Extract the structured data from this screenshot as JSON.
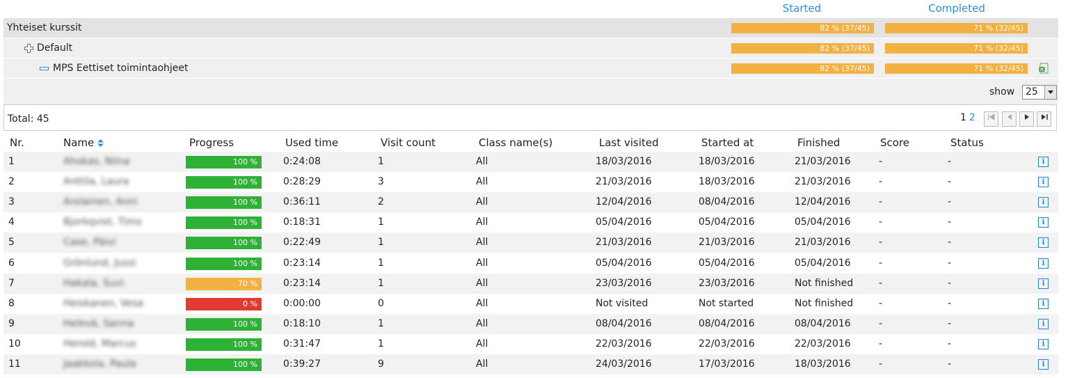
{
  "summary": {
    "started_header": "Started",
    "completed_header": "Completed",
    "rows": [
      {
        "label": "Yhteiset kurssit",
        "started": "82 % (37/45)",
        "completed": "71 % (32/45)"
      },
      {
        "label": "Default",
        "started": "82 % (37/45)",
        "completed": "71 % (32/45)"
      },
      {
        "label": "MPS Eettiset toimintaohjeet",
        "started": "82 % (37/45)",
        "completed": "71 % (32/45)"
      }
    ]
  },
  "show": {
    "label": "show",
    "value": "25"
  },
  "total": "Total: 45",
  "pagination": {
    "page1": "1",
    "page2": "2"
  },
  "colors": {
    "accent": "#2a8fd4",
    "green": "#2eb236",
    "orange": "#f3b043",
    "red": "#e23a33"
  },
  "columns": [
    "Nr.",
    "Name",
    "Progress",
    "Used time",
    "Visit count",
    "Class name(s)",
    "Last visited",
    "Started at",
    "Finished",
    "Score",
    "Status"
  ],
  "rows": [
    {
      "nr": "1",
      "name": "Ahokas, Niina",
      "progress": "100 %",
      "pval": 100,
      "used": "0:24:08",
      "visits": "1",
      "cls": "All",
      "last": "18/03/2016",
      "started": "18/03/2016",
      "finished": "21/03/2016",
      "score": "-",
      "status": "-"
    },
    {
      "nr": "2",
      "name": "Anttila, Laura",
      "progress": "100 %",
      "pval": 100,
      "used": "0:28:29",
      "visits": "3",
      "cls": "All",
      "last": "21/03/2016",
      "started": "18/03/2016",
      "finished": "21/03/2016",
      "score": "-",
      "status": "-"
    },
    {
      "nr": "3",
      "name": "Arolainen, Anni",
      "progress": "100 %",
      "pval": 100,
      "used": "0:36:11",
      "visits": "2",
      "cls": "All",
      "last": "12/04/2016",
      "started": "08/04/2016",
      "finished": "12/04/2016",
      "score": "-",
      "status": "-"
    },
    {
      "nr": "4",
      "name": "Bjorkqvist, Timo",
      "progress": "100 %",
      "pval": 100,
      "used": "0:18:31",
      "visits": "1",
      "cls": "All",
      "last": "05/04/2016",
      "started": "05/04/2016",
      "finished": "05/04/2016",
      "score": "-",
      "status": "-"
    },
    {
      "nr": "5",
      "name": "Case, Päivi",
      "progress": "100 %",
      "pval": 100,
      "used": "0:22:49",
      "visits": "1",
      "cls": "All",
      "last": "21/03/2016",
      "started": "21/03/2016",
      "finished": "21/03/2016",
      "score": "-",
      "status": "-"
    },
    {
      "nr": "6",
      "name": "Grönlund, Jussi",
      "progress": "100 %",
      "pval": 100,
      "used": "0:23:14",
      "visits": "1",
      "cls": "All",
      "last": "05/04/2016",
      "started": "05/04/2016",
      "finished": "05/04/2016",
      "score": "-",
      "status": "-"
    },
    {
      "nr": "7",
      "name": "Hakala, Suvi",
      "progress": "70 %",
      "pval": 70,
      "used": "0:23:14",
      "visits": "1",
      "cls": "All",
      "last": "23/03/2016",
      "started": "23/03/2016",
      "finished": "Not finished",
      "score": "-",
      "status": "-"
    },
    {
      "nr": "8",
      "name": "Heiskanen, Vesa",
      "progress": "0 %",
      "pval": 0,
      "used": "0:00:00",
      "visits": "0",
      "cls": "All",
      "last": "Not visited",
      "started": "Not started",
      "finished": "Not finished",
      "score": "-",
      "status": "-"
    },
    {
      "nr": "9",
      "name": "Helevä, Sanna",
      "progress": "100 %",
      "pval": 100,
      "used": "0:18:10",
      "visits": "1",
      "cls": "All",
      "last": "08/04/2016",
      "started": "08/04/2016",
      "finished": "08/04/2016",
      "score": "-",
      "status": "-"
    },
    {
      "nr": "10",
      "name": "Herold, Marcus",
      "progress": "100 %",
      "pval": 100,
      "used": "0:31:47",
      "visits": "1",
      "cls": "All",
      "last": "22/03/2016",
      "started": "22/03/2016",
      "finished": "22/03/2016",
      "score": "-",
      "status": "-"
    },
    {
      "nr": "11",
      "name": "Jaakkola, Paula",
      "progress": "100 %",
      "pval": 100,
      "used": "0:39:27",
      "visits": "9",
      "cls": "All",
      "last": "24/03/2016",
      "started": "17/03/2016",
      "finished": "18/03/2016",
      "score": "-",
      "status": "-"
    }
  ]
}
